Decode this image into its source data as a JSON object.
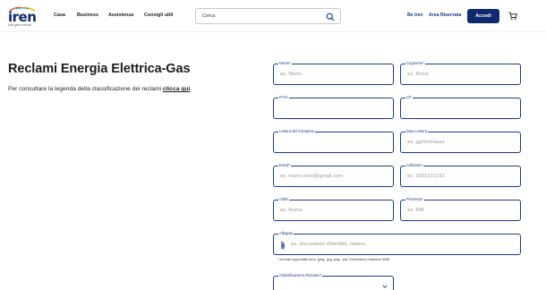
{
  "header": {
    "logo": {
      "brand": "iren",
      "tagline": "luce gas e servizi"
    },
    "nav": [
      "Casa",
      "Business",
      "Assistenza",
      "Consigli utili"
    ],
    "search_placeholder": "Cerca",
    "links": [
      "Be Iren",
      "Area Riservata"
    ],
    "login_label": "Accedi"
  },
  "page": {
    "title": "Reclami Energia Elettrica-Gas",
    "intro_text": "Per consultare la legenda della classificazione dei reclami ",
    "intro_link": "clicca qui",
    "intro_end": "."
  },
  "form": {
    "nome": {
      "label": "Nome*",
      "placeholder": "es. Mario"
    },
    "cognome": {
      "label": "Cognome*",
      "placeholder": "es. Rossi"
    },
    "piva": {
      "label": "P.IVA",
      "placeholder": ""
    },
    "cf": {
      "label": "CF",
      "placeholder": ""
    },
    "lettura": {
      "label": "Lettura del Contatore",
      "placeholder": ""
    },
    "data_lettura": {
      "label": "Data Lettura",
      "placeholder": "es. gg/mm/aaaa"
    },
    "email": {
      "label": "Email*",
      "placeholder": "es. mario.rossi@gmail.com"
    },
    "cellulare": {
      "label": "Cellulare*",
      "placeholder": "es. 3331231232"
    },
    "citta": {
      "label": "Città*",
      "placeholder": "es. Roma"
    },
    "provincia": {
      "label": "Provincia*",
      "placeholder": "es. RM"
    },
    "allegato": {
      "label": "Allegato",
      "placeholder": "es. documento d'identità, fattura..."
    },
    "allegato_hint": "I formati supportati sono .jpeg, .jpg,.png, .pdf. Dimensioni massime 5MB",
    "classificazione": {
      "label": "Classificazione Reclamo*",
      "value": ""
    }
  },
  "colors": {
    "brand": "#0f2a6e",
    "accent": "#1b3a8c"
  }
}
